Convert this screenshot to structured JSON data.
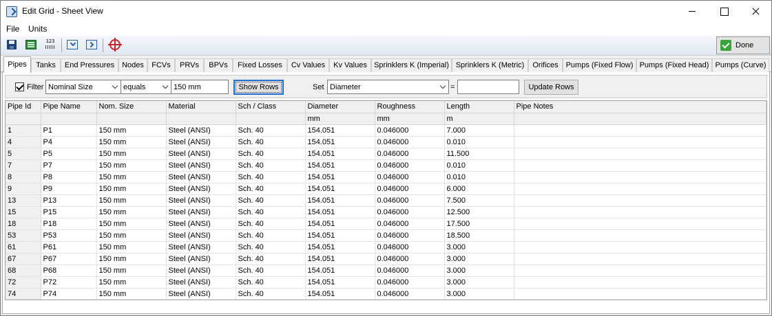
{
  "window": {
    "title": "Edit Grid - Sheet View"
  },
  "menu": [
    "File",
    "Units"
  ],
  "toolbar": {
    "icons": [
      "save-icon",
      "sheet-icon",
      "number-format-icon",
      "import-icon",
      "export-icon",
      "target-icon"
    ],
    "done_label": "Done"
  },
  "tabs": [
    "Pipes",
    "Tanks",
    "End Pressures",
    "Nodes",
    "FCVs",
    "PRVs",
    "BPVs",
    "Fixed Losses",
    "Cv Values",
    "Kv Values",
    "Sprinklers K (Imperial)",
    "Sprinklers K (Metric)",
    "Orifices",
    "Pumps (Fixed Flow)",
    "Pumps (Fixed Head)",
    "Pumps (Curve)"
  ],
  "active_tab": "Pipes",
  "filter": {
    "label": "Filter",
    "checked": true,
    "field": "Nominal Size",
    "operator": "equals",
    "value": "150 mm",
    "show_rows_label": "Show Rows"
  },
  "set": {
    "label": "Set",
    "field": "Diameter",
    "equals": "=",
    "value": "",
    "update_rows_label": "Update Rows"
  },
  "grid": {
    "columns": [
      "Pipe Id",
      "Pipe Name",
      "Nom. Size",
      "Material",
      "Sch / Class",
      "Diameter",
      "Roughness",
      "Length",
      "Pipe Notes"
    ],
    "units": [
      "",
      "",
      "",
      "",
      "",
      "mm",
      "mm",
      "m",
      ""
    ],
    "rows": [
      [
        "1",
        "P1",
        "150 mm",
        "Steel (ANSI)",
        "Sch.  40",
        "154.051",
        "0.046000",
        "7.000",
        ""
      ],
      [
        "4",
        "P4",
        "150 mm",
        "Steel (ANSI)",
        "Sch.  40",
        "154.051",
        "0.046000",
        "0.010",
        ""
      ],
      [
        "5",
        "P5",
        "150 mm",
        "Steel (ANSI)",
        "Sch.  40",
        "154.051",
        "0.046000",
        "11.500",
        ""
      ],
      [
        "7",
        "P7",
        "150 mm",
        "Steel (ANSI)",
        "Sch.  40",
        "154.051",
        "0.046000",
        "0.010",
        ""
      ],
      [
        "8",
        "P8",
        "150 mm",
        "Steel (ANSI)",
        "Sch.  40",
        "154.051",
        "0.046000",
        "0.010",
        ""
      ],
      [
        "9",
        "P9",
        "150 mm",
        "Steel (ANSI)",
        "Sch.  40",
        "154.051",
        "0.046000",
        "6.000",
        ""
      ],
      [
        "13",
        "P13",
        "150 mm",
        "Steel (ANSI)",
        "Sch.  40",
        "154.051",
        "0.046000",
        "7.500",
        ""
      ],
      [
        "15",
        "P15",
        "150 mm",
        "Steel (ANSI)",
        "Sch.  40",
        "154.051",
        "0.046000",
        "12.500",
        ""
      ],
      [
        "18",
        "P18",
        "150 mm",
        "Steel (ANSI)",
        "Sch.  40",
        "154.051",
        "0.046000",
        "17.500",
        ""
      ],
      [
        "53",
        "P53",
        "150 mm",
        "Steel (ANSI)",
        "Sch.  40",
        "154.051",
        "0.046000",
        "18.500",
        ""
      ],
      [
        "61",
        "P61",
        "150 mm",
        "Steel (ANSI)",
        "Sch.  40",
        "154.051",
        "0.046000",
        "3.000",
        ""
      ],
      [
        "67",
        "P67",
        "150 mm",
        "Steel (ANSI)",
        "Sch.  40",
        "154.051",
        "0.046000",
        "3.000",
        ""
      ],
      [
        "68",
        "P68",
        "150 mm",
        "Steel (ANSI)",
        "Sch.  40",
        "154.051",
        "0.046000",
        "3.000",
        ""
      ],
      [
        "72",
        "P72",
        "150 mm",
        "Steel (ANSI)",
        "Sch.  40",
        "154.051",
        "0.046000",
        "3.000",
        ""
      ],
      [
        "74",
        "P74",
        "150 mm",
        "Steel (ANSI)",
        "Sch.  40",
        "154.051",
        "0.046000",
        "3.000",
        ""
      ]
    ]
  },
  "colors": {
    "accent": "#1e6fd9",
    "done_check": "#3aa33a",
    "target": "#c62828"
  }
}
